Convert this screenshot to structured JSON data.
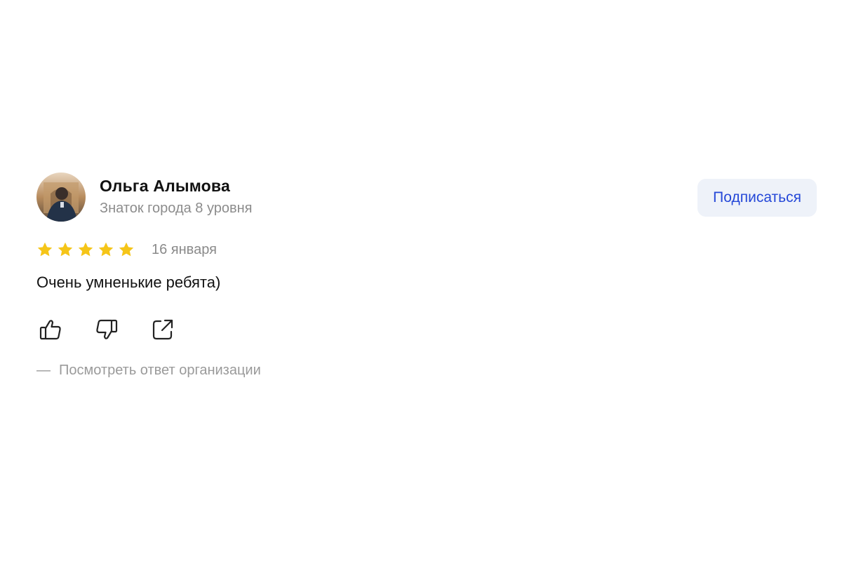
{
  "review": {
    "author": {
      "name": "Ольга Алымова",
      "level": "Знаток города 8 уровня",
      "avatar_icon": "user-photo"
    },
    "subscribe_label": "Подписаться",
    "rating": 5,
    "rating_max": 5,
    "date": "16 января",
    "text": "Очень умненькие ребята)",
    "actions": [
      {
        "icon": "thumbs-up-icon"
      },
      {
        "icon": "thumbs-down-icon"
      },
      {
        "icon": "share-icon"
      }
    ],
    "org_reply": {
      "dash": "—",
      "label": "Посмотреть ответ организации"
    }
  },
  "colors": {
    "star": "#f5c518",
    "link_blue": "#2548d8",
    "button_bg": "#eef2f9",
    "muted_text": "#8c8c8c"
  }
}
